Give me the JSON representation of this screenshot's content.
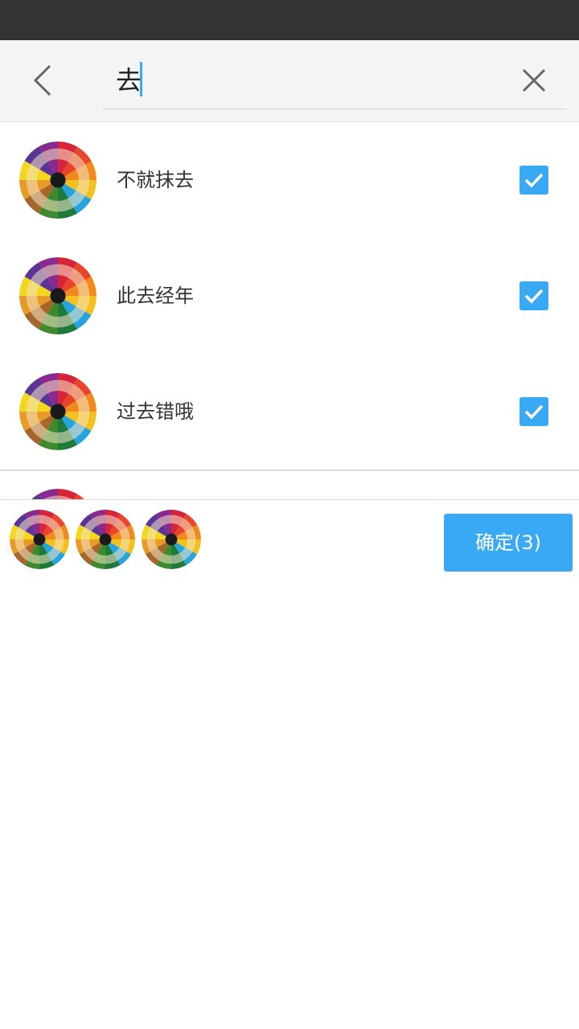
{
  "search": {
    "query": "去"
  },
  "icons": {
    "back": "chevron-left-icon",
    "clear": "close-icon",
    "check": "checkmark-icon",
    "avatar": "colored-pencils-avatar"
  },
  "colors": {
    "accent": "#3aa9f4",
    "status_bar": "#333333",
    "header_bg": "#f4f4f4"
  },
  "contacts": [
    {
      "name": "不就抹去",
      "checked": true
    },
    {
      "name": "此去经年",
      "checked": true
    },
    {
      "name": "过去错哦",
      "checked": true
    }
  ],
  "selected_count": 3,
  "confirm_label": "确定(3)"
}
